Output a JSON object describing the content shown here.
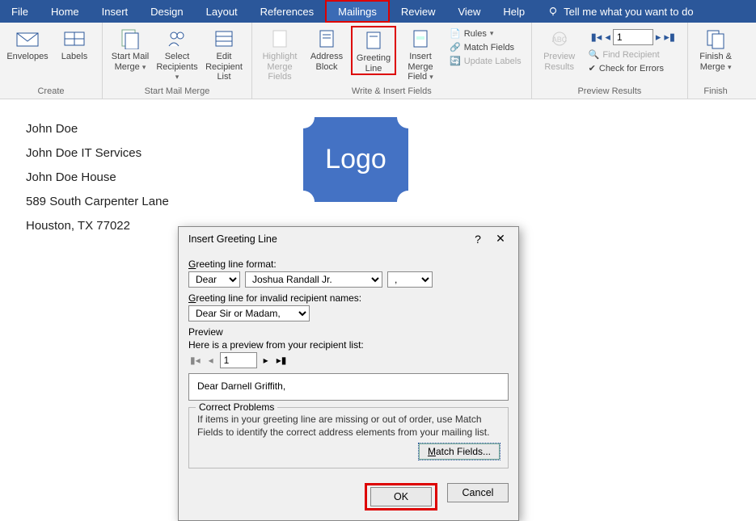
{
  "menu": {
    "tabs": [
      "File",
      "Home",
      "Insert",
      "Design",
      "Layout",
      "References",
      "Mailings",
      "Review",
      "View",
      "Help"
    ],
    "tell": "Tell me what you want to do"
  },
  "ribbon": {
    "create": {
      "label": "Create",
      "envelopes": "Envelopes",
      "labels": "Labels"
    },
    "start": {
      "label": "Start Mail Merge",
      "startmm": "Start Mail Merge",
      "select": "Select Recipients",
      "edit": "Edit Recipient List"
    },
    "write": {
      "label": "Write & Insert Fields",
      "highlight": "Highlight Merge Fields",
      "address": "Address Block",
      "greeting": "Greeting Line",
      "insertmf": "Insert Merge Field",
      "rules": "Rules",
      "match": "Match Fields",
      "update": "Update Labels"
    },
    "preview": {
      "label": "Preview Results",
      "preview": "Preview Results",
      "find": "Find Recipient",
      "check": "Check for Errors",
      "recnum": "1"
    },
    "finish": {
      "label": "Finish",
      "finish": "Finish & Merge"
    }
  },
  "doc": {
    "line1": "John Doe",
    "line2": "John Doe IT Services",
    "line3": "John Doe House",
    "line4": "589 South Carpenter Lane",
    "line5": "Houston, TX 77022",
    "logo": "Logo"
  },
  "dialog": {
    "title": "Insert Greeting Line",
    "format_label": "Greeting line format:",
    "salutation": "Dear",
    "name": "Joshua Randall Jr.",
    "punct": ",",
    "invalid_label": "Greeting line for invalid recipient names:",
    "invalid_value": "Dear Sir or Madam,",
    "preview_label": "Preview",
    "preview_desc": "Here is a preview from your recipient list:",
    "recnum": "1",
    "preview_value": "Dear Darnell Griffith,",
    "correct_title": "Correct Problems",
    "correct_desc": "If items in your greeting line are missing or out of order, use Match Fields to identify the correct address elements from your mailing list.",
    "match": "Match Fields...",
    "ok": "OK",
    "cancel": "Cancel"
  }
}
